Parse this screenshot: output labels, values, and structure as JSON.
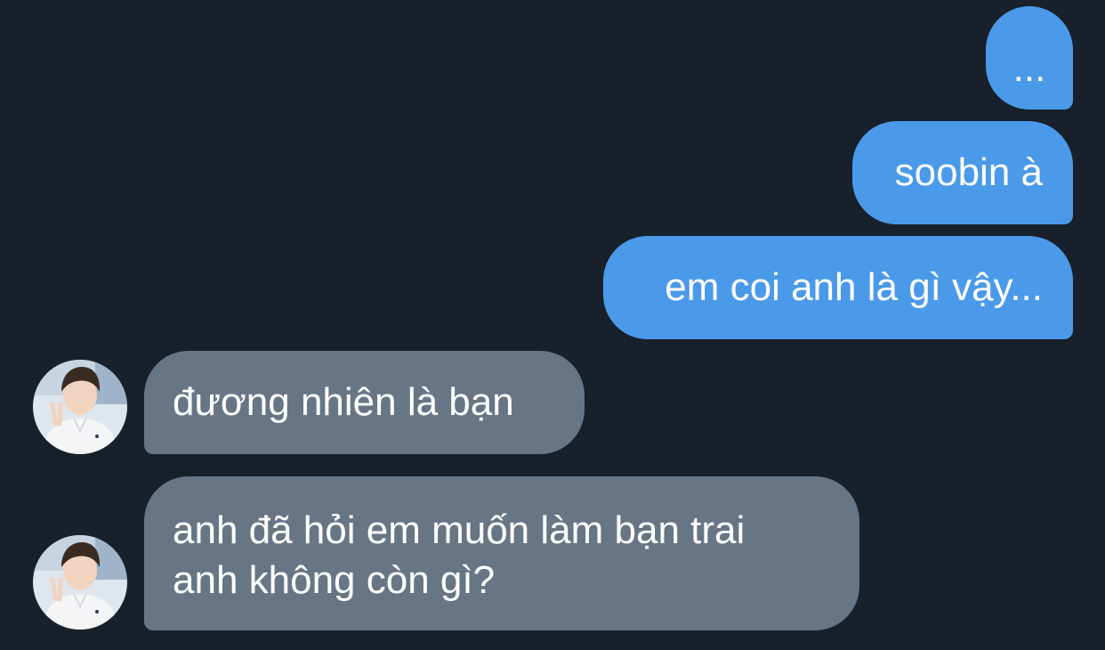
{
  "conversation": {
    "messages": [
      {
        "sender": "me",
        "text": "..."
      },
      {
        "sender": "me",
        "text": "soobin à"
      },
      {
        "sender": "me",
        "text": "em coi anh là gì vậy..."
      },
      {
        "sender": "other",
        "text": "đương nhiên là bạn",
        "avatar": "profile-photo"
      },
      {
        "sender": "other",
        "text": "anh đã hỏi em muốn làm bạn trai\nanh không còn gì?",
        "avatar": "profile-photo"
      }
    ]
  },
  "colors": {
    "background": "#18202b",
    "outgoing_bubble": "#4a9ae9",
    "incoming_bubble": "#687585",
    "text": "#ffffff"
  }
}
